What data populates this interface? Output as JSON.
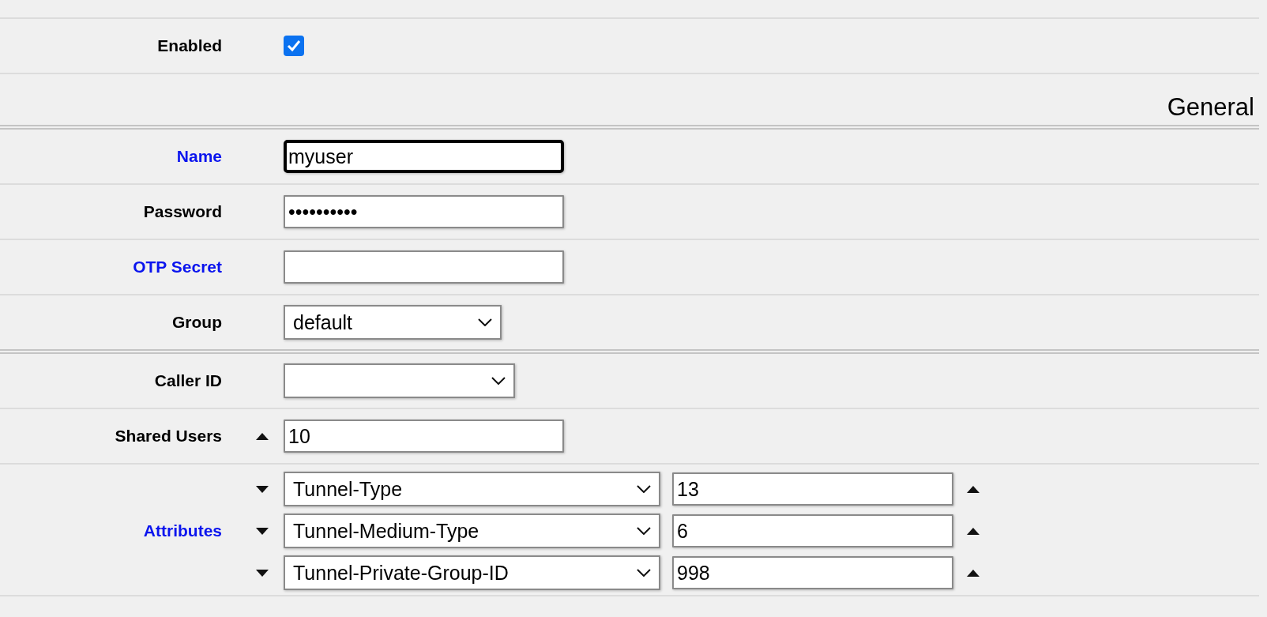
{
  "form": [
    {
      "kind": "checkbox",
      "label": "Enabled",
      "highlighted": false,
      "checked": true
    },
    {
      "kind": "section",
      "title": "General"
    },
    {
      "kind": "text",
      "label": "Name",
      "highlighted": true,
      "value": "myuser",
      "focused": true
    },
    {
      "kind": "text",
      "label": "Password",
      "highlighted": false,
      "value": "••••••••••",
      "focused": false
    },
    {
      "kind": "text",
      "label": "OTP Secret",
      "highlighted": true,
      "focused": false
    },
    {
      "kind": "dropdown",
      "label": "Group",
      "highlighted": false,
      "value": "default"
    },
    {
      "kind": "divider"
    },
    {
      "kind": "dropdown",
      "label": "Caller ID",
      "highlighted": false
    },
    {
      "kind": "number",
      "label": "Shared Users",
      "highlighted": false,
      "value": "10"
    },
    {
      "kind": "attributes",
      "label": "Attributes",
      "highlighted": true,
      "items": [
        {
          "name": "Tunnel-Type",
          "value": "13"
        },
        {
          "name": "Tunnel-Medium-Type",
          "value": "6"
        },
        {
          "name": "Tunnel-Private-Group-ID",
          "value": "998"
        }
      ]
    }
  ]
}
